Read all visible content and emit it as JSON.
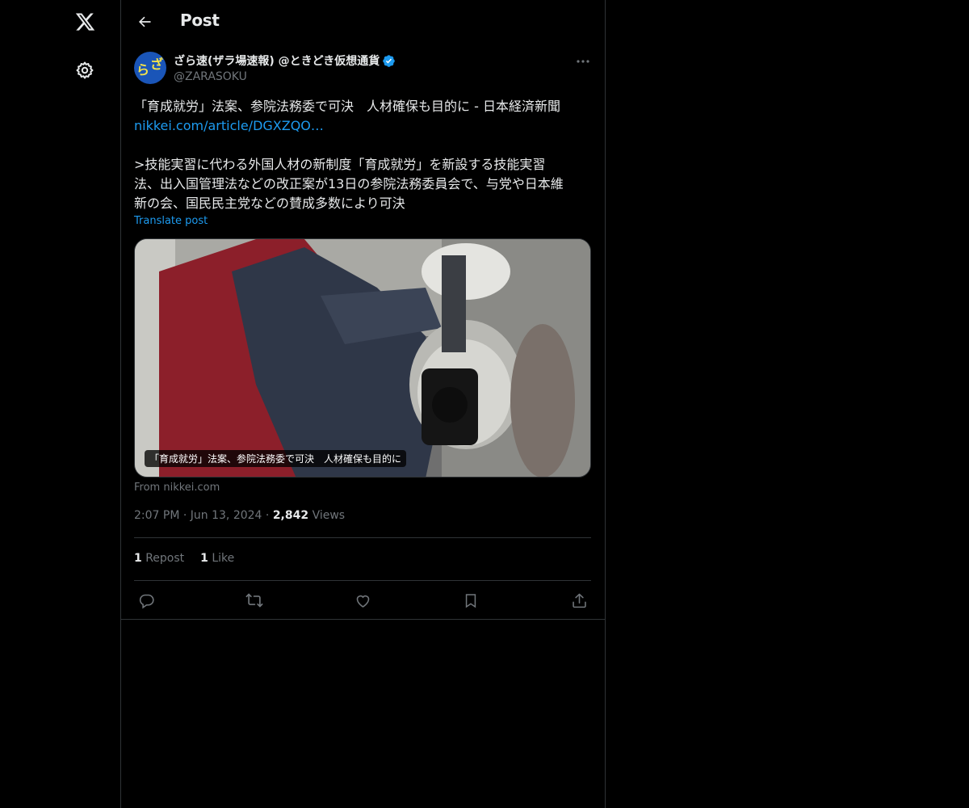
{
  "sidebar": {
    "logo_icon": "x-logo-icon",
    "settings_icon": "gear-icon"
  },
  "header": {
    "title": "Post",
    "back_icon": "arrow-left-icon"
  },
  "post": {
    "avatar_text_1": "ら",
    "avatar_text_2": "ざ",
    "display_name": "ざら速(ザラ場速報) @ときどき仮想通貨",
    "handle": "@ZARASOKU",
    "verified": true,
    "line1": "「育成就労」法案、参院法務委で可決　人材確保も目的に - 日本経済新聞",
    "link": "nikkei.com/article/DGXZQO…",
    "para_line1": ">技能実習に代わる外国人材の新制度「育成就労」を新設する技能実習",
    "para_line2": "法、出入国管理法などの改正案が13日の参院法務委員会で、与党や日本維",
    "para_line3": "新の会、国民民主党などの賛成多数により可決",
    "translate_label": "Translate post",
    "card_caption": "「育成就労」法案、参院法務委で可決　人材確保も目的に",
    "card_source": "From nikkei.com",
    "time": "2:07 PM",
    "date": "Jun 13, 2024",
    "views_count": "2,842",
    "views_label": "Views",
    "reposts_count": "1",
    "reposts_label": "Repost",
    "likes_count": "1",
    "likes_label": "Like"
  },
  "colors": {
    "accent": "#1d9bf0",
    "background": "#000000",
    "text": "#e7e9ea",
    "muted": "#71767b",
    "border": "#2f3336"
  }
}
